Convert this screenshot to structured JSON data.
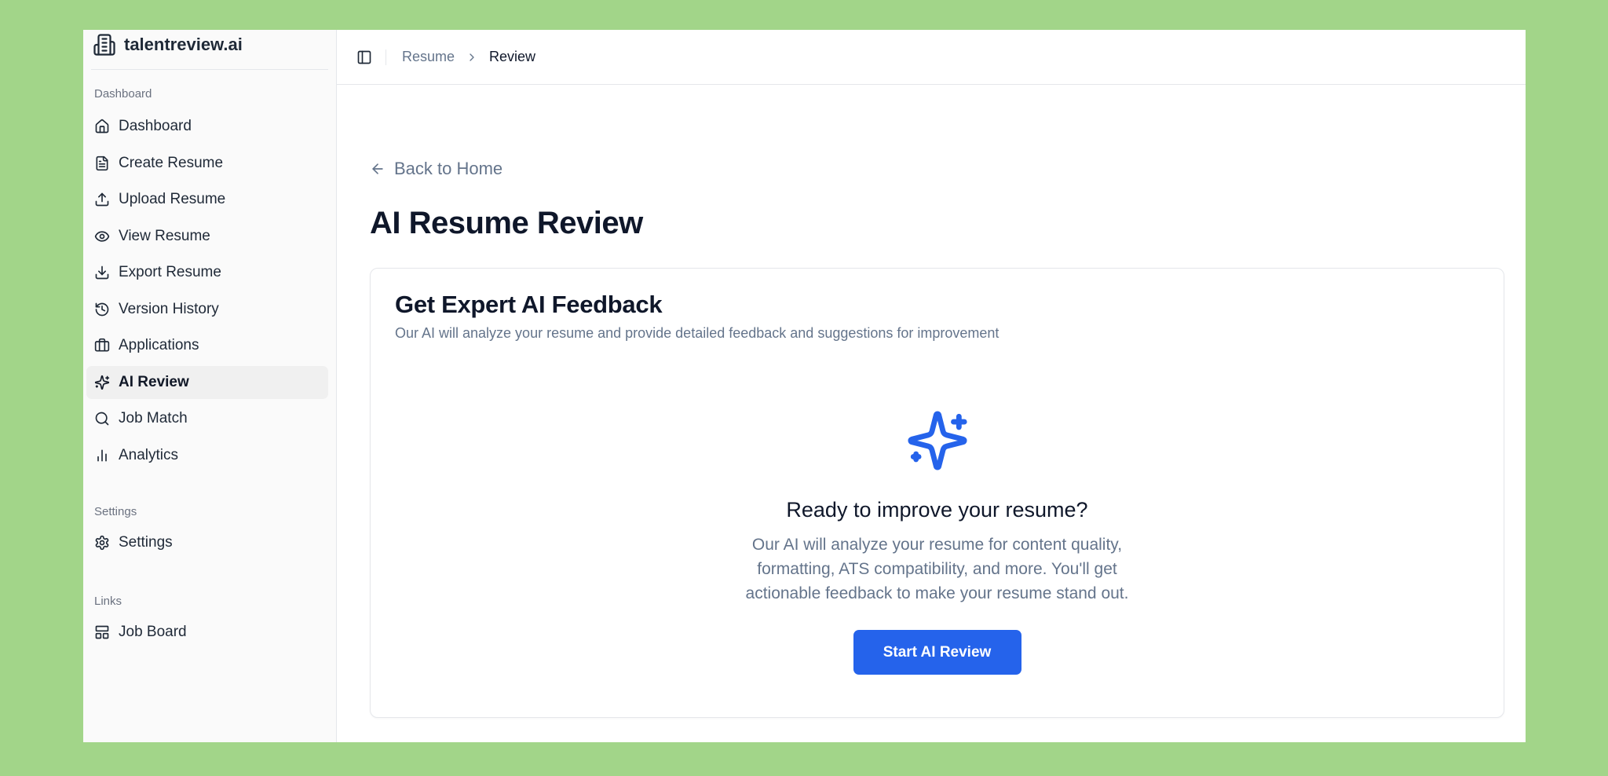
{
  "brand": {
    "name": "talentreview.ai",
    "icon": "building-icon"
  },
  "sidebar": {
    "groups": [
      {
        "label": "Dashboard",
        "items": [
          {
            "label": "Dashboard",
            "icon": "home-icon"
          },
          {
            "label": "Create Resume",
            "icon": "file-text-icon"
          },
          {
            "label": "Upload Resume",
            "icon": "upload-icon"
          },
          {
            "label": "View Resume",
            "icon": "eye-icon"
          },
          {
            "label": "Export Resume",
            "icon": "download-icon"
          },
          {
            "label": "Version History",
            "icon": "history-icon"
          },
          {
            "label": "Applications",
            "icon": "briefcase-icon"
          },
          {
            "label": "AI Review",
            "icon": "sparkles-icon",
            "active": true
          },
          {
            "label": "Job Match",
            "icon": "search-icon"
          },
          {
            "label": "Analytics",
            "icon": "bar-chart-icon"
          }
        ]
      },
      {
        "label": "Settings",
        "items": [
          {
            "label": "Settings",
            "icon": "gear-icon"
          }
        ]
      },
      {
        "label": "Links",
        "items": [
          {
            "label": "Job Board",
            "icon": "layout-icon"
          }
        ]
      }
    ]
  },
  "header": {
    "breadcrumb": {
      "parent": "Resume",
      "current": "Review"
    }
  },
  "main": {
    "back_link": "Back to Home",
    "page_title": "AI Resume Review",
    "card": {
      "title": "Get Expert AI Feedback",
      "subtitle": "Our AI will analyze your resume and provide detailed feedback and suggestions for improvement",
      "cta_title": "Ready to improve your resume?",
      "cta_description": "Our AI will analyze your resume for content quality, formatting, ATS compatibility, and more. You'll get actionable feedback to make your resume stand out.",
      "button_label": "Start AI Review"
    }
  },
  "colors": {
    "background": "#a2d589",
    "accent": "#2563eb",
    "sidebar_bg": "#fafafa",
    "muted_text": "#64748b"
  }
}
